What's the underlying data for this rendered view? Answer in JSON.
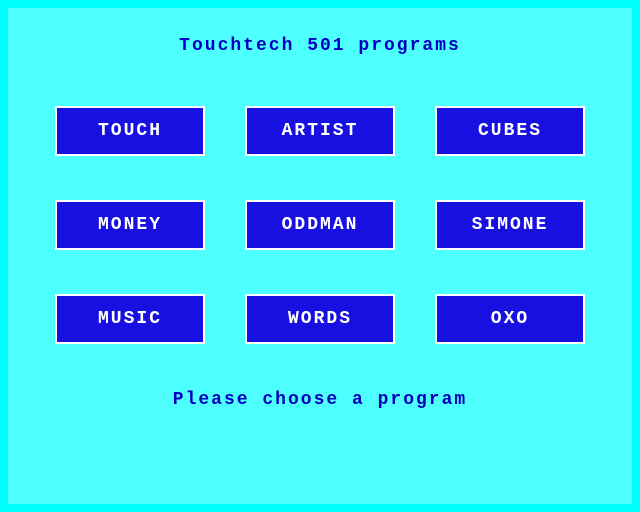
{
  "title": "Touchtech 501 programs",
  "programs": [
    "TOUCH",
    "ARTIST",
    "CUBES",
    "MONEY",
    "ODDMAN",
    "SIMONE",
    "MUSIC",
    "WORDS",
    "OXO"
  ],
  "footer": "Please choose a program",
  "colors": {
    "background_outer": "#00ffff",
    "background_inner": "#4dffff",
    "button_fill": "#1710e0",
    "button_border": "#ffffff",
    "text_title": "#0000c0"
  }
}
